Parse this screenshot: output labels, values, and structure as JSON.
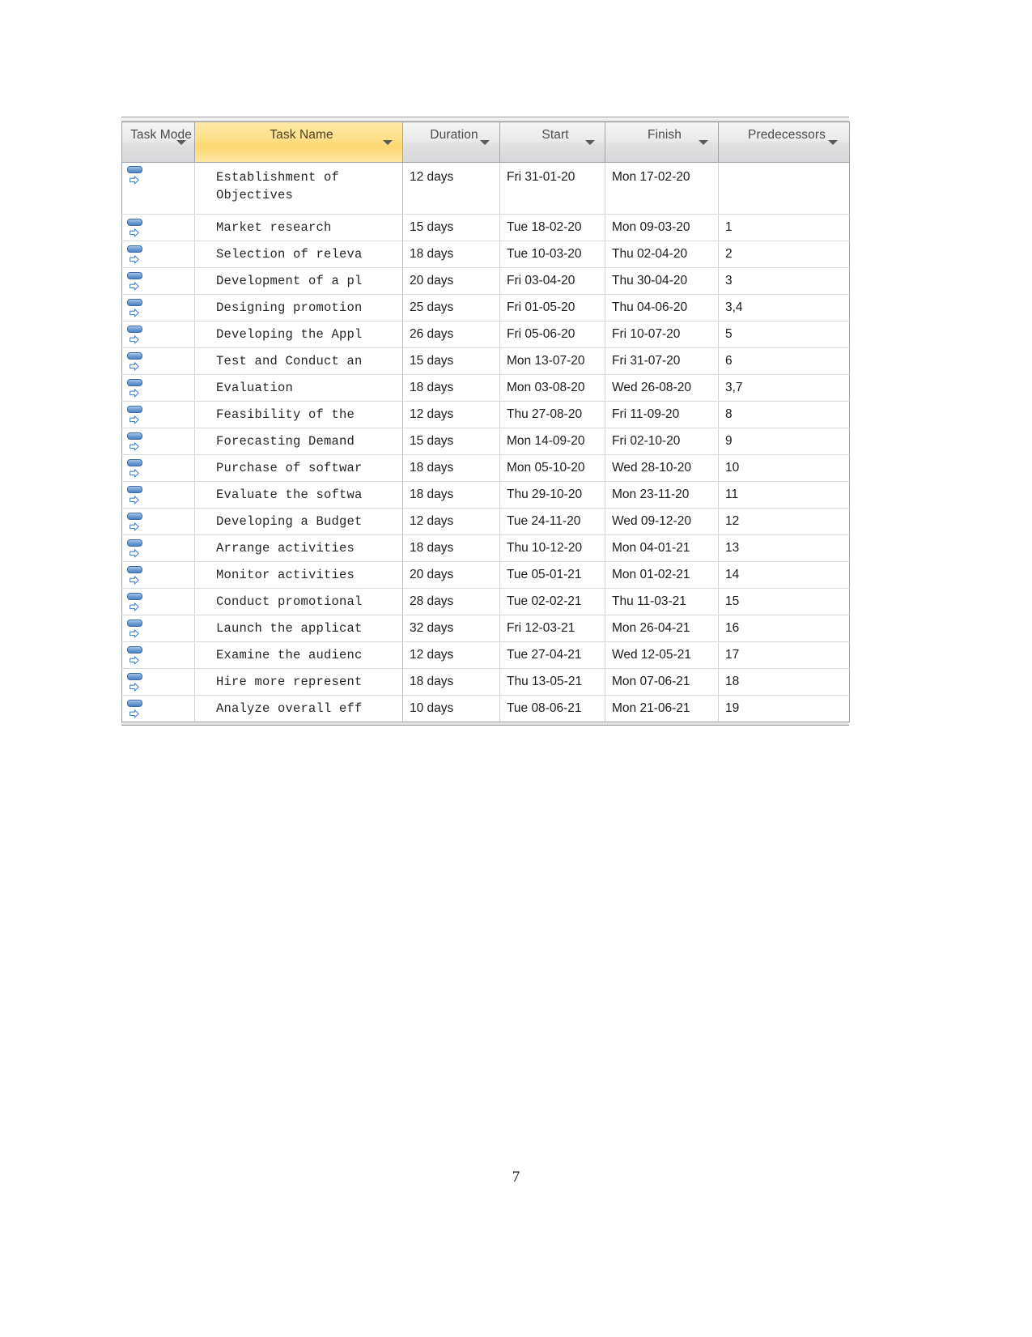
{
  "document": {
    "page_number": "7"
  },
  "table": {
    "columns": [
      {
        "key": "task_mode",
        "label": "Task Mode",
        "selected": false,
        "has_filter": true
      },
      {
        "key": "task_name",
        "label": "Task Name",
        "selected": true,
        "has_filter": true
      },
      {
        "key": "duration",
        "label": "Duration",
        "selected": false,
        "has_filter": true
      },
      {
        "key": "start",
        "label": "Start",
        "selected": false,
        "has_filter": true
      },
      {
        "key": "finish",
        "label": "Finish",
        "selected": false,
        "has_filter": true
      },
      {
        "key": "predecessors",
        "label": "Predecessors",
        "selected": false,
        "has_filter": true
      }
    ],
    "colors": {
      "header_background": "#e4e5e7",
      "header_selected_background": "#ffdf8a",
      "header_text": "#4b4b4b",
      "grid_line": "#d2d5d8",
      "border": "#9fa3a8",
      "mode_icon_blue": "#4b83c4"
    },
    "mode_icon_name": "manually-scheduled-task-icon",
    "rows": [
      {
        "mode": "manually-scheduled-task-icon",
        "name": "Establishment of Objectives",
        "duration": "12 days",
        "start": "Fri 31-01-20",
        "finish": "Mon 17-02-20",
        "predecessors": "",
        "tall": true
      },
      {
        "mode": "manually-scheduled-task-icon",
        "name": "Market research",
        "duration": "15 days",
        "start": "Tue 18-02-20",
        "finish": "Mon 09-03-20",
        "predecessors": "1",
        "tall": false
      },
      {
        "mode": "manually-scheduled-task-icon",
        "name": "Selection of releva",
        "duration": "18 days",
        "start": "Tue 10-03-20",
        "finish": "Thu 02-04-20",
        "predecessors": "2",
        "tall": false
      },
      {
        "mode": "manually-scheduled-task-icon",
        "name": "Development of a pl",
        "duration": "20 days",
        "start": "Fri 03-04-20",
        "finish": "Thu 30-04-20",
        "predecessors": "3",
        "tall": false
      },
      {
        "mode": "manually-scheduled-task-icon",
        "name": "Designing promotion",
        "duration": "25 days",
        "start": "Fri 01-05-20",
        "finish": "Thu 04-06-20",
        "predecessors": "3,4",
        "tall": false
      },
      {
        "mode": "manually-scheduled-task-icon",
        "name": "Developing the Appl",
        "duration": "26 days",
        "start": "Fri 05-06-20",
        "finish": "Fri 10-07-20",
        "predecessors": "5",
        "tall": false
      },
      {
        "mode": "manually-scheduled-task-icon",
        "name": "Test and Conduct an",
        "duration": "15 days",
        "start": "Mon 13-07-20",
        "finish": "Fri 31-07-20",
        "predecessors": "6",
        "tall": false
      },
      {
        "mode": "manually-scheduled-task-icon",
        "name": "Evaluation",
        "duration": "18 days",
        "start": "Mon 03-08-20",
        "finish": "Wed 26-08-20",
        "predecessors": "3,7",
        "tall": false
      },
      {
        "mode": "manually-scheduled-task-icon",
        "name": "Feasibility of the",
        "duration": "12 days",
        "start": "Thu 27-08-20",
        "finish": "Fri 11-09-20",
        "predecessors": "8",
        "tall": false
      },
      {
        "mode": "manually-scheduled-task-icon",
        "name": "Forecasting Demand",
        "duration": "15 days",
        "start": "Mon 14-09-20",
        "finish": "Fri 02-10-20",
        "predecessors": "9",
        "tall": false
      },
      {
        "mode": "manually-scheduled-task-icon",
        "name": "Purchase of softwar",
        "duration": "18 days",
        "start": "Mon 05-10-20",
        "finish": "Wed 28-10-20",
        "predecessors": "10",
        "tall": false
      },
      {
        "mode": "manually-scheduled-task-icon",
        "name": "Evaluate the softwa",
        "duration": "18 days",
        "start": "Thu 29-10-20",
        "finish": "Mon 23-11-20",
        "predecessors": "11",
        "tall": false
      },
      {
        "mode": "manually-scheduled-task-icon",
        "name": "Developing a Budget",
        "duration": "12 days",
        "start": "Tue 24-11-20",
        "finish": "Wed 09-12-20",
        "predecessors": "12",
        "tall": false
      },
      {
        "mode": "manually-scheduled-task-icon",
        "name": "Arrange activities",
        "duration": "18 days",
        "start": "Thu 10-12-20",
        "finish": "Mon 04-01-21",
        "predecessors": "13",
        "tall": false
      },
      {
        "mode": "manually-scheduled-task-icon",
        "name": "Monitor activities",
        "duration": "20 days",
        "start": "Tue 05-01-21",
        "finish": "Mon 01-02-21",
        "predecessors": "14",
        "tall": false
      },
      {
        "mode": "manually-scheduled-task-icon",
        "name": "Conduct promotional",
        "duration": "28 days",
        "start": "Tue 02-02-21",
        "finish": "Thu 11-03-21",
        "predecessors": "15",
        "tall": false
      },
      {
        "mode": "manually-scheduled-task-icon",
        "name": "Launch the applicat",
        "duration": "32 days",
        "start": "Fri 12-03-21",
        "finish": "Mon 26-04-21",
        "predecessors": "16",
        "tall": false
      },
      {
        "mode": "manually-scheduled-task-icon",
        "name": "Examine the audienc",
        "duration": "12 days",
        "start": "Tue 27-04-21",
        "finish": "Wed 12-05-21",
        "predecessors": "17",
        "tall": false
      },
      {
        "mode": "manually-scheduled-task-icon",
        "name": "Hire more represent",
        "duration": "18 days",
        "start": "Thu 13-05-21",
        "finish": "Mon 07-06-21",
        "predecessors": "18",
        "tall": false
      },
      {
        "mode": "manually-scheduled-task-icon",
        "name": "Analyze overall eff",
        "duration": "10 days",
        "start": "Tue 08-06-21",
        "finish": "Mon 21-06-21",
        "predecessors": "19",
        "tall": false
      }
    ]
  }
}
